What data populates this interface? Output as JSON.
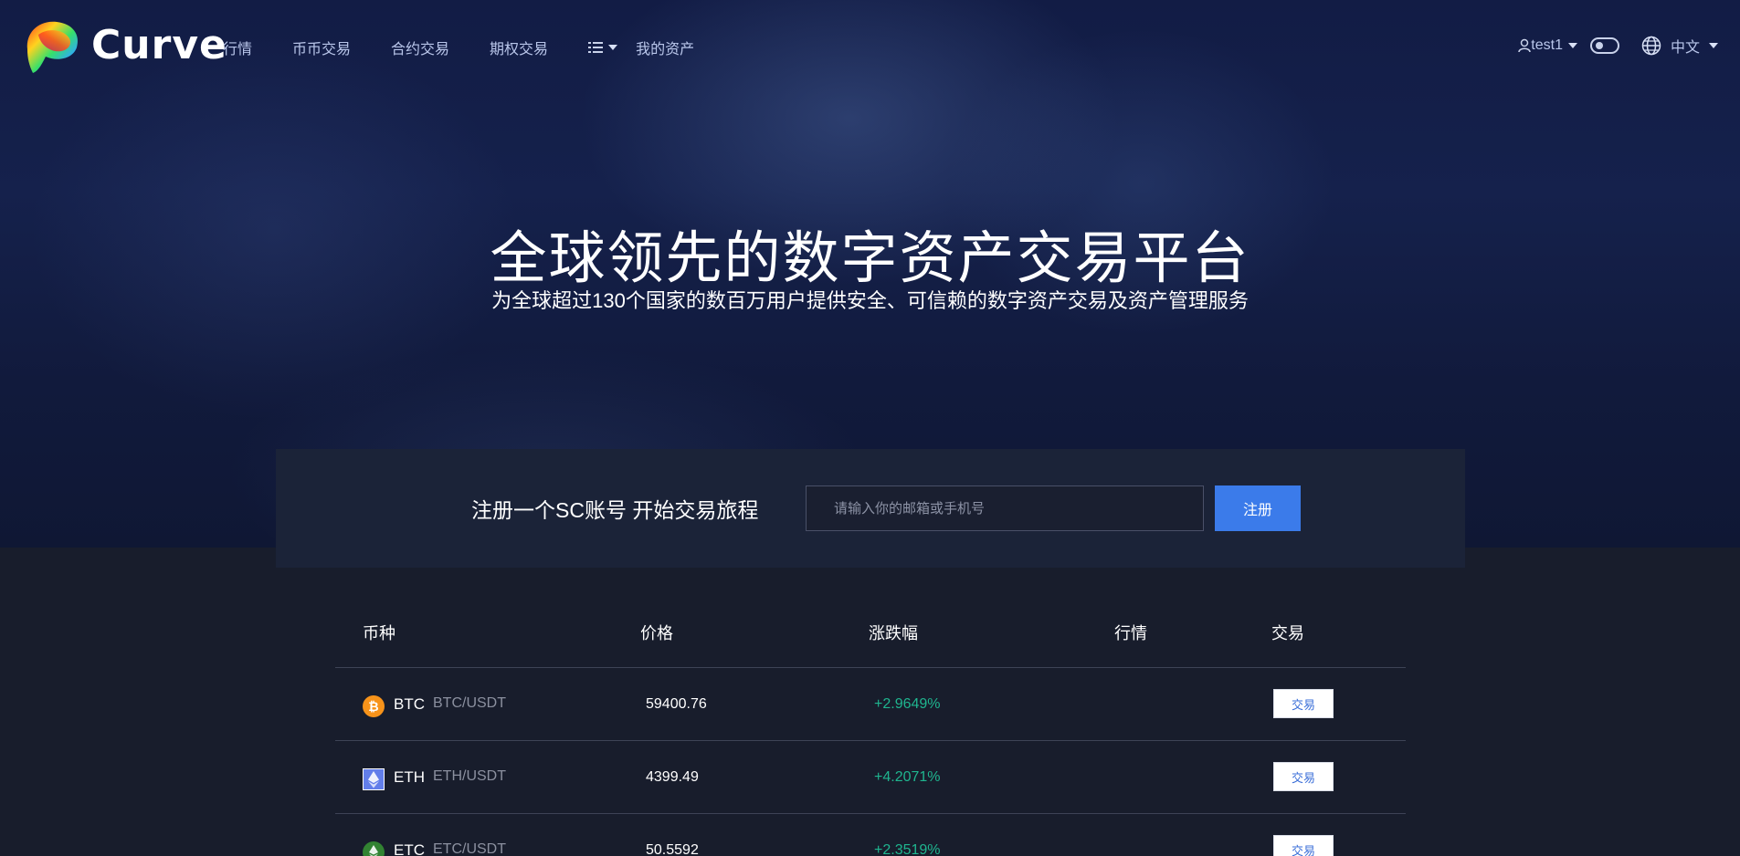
{
  "brand": {
    "name": "Curve"
  },
  "nav": {
    "links": [
      "行情",
      "币币交易",
      "合约交易",
      "期权交易"
    ],
    "assets": "我的资产",
    "user": "test1",
    "language": "中文"
  },
  "hero": {
    "title": "全球领先的数字资产交易平台",
    "subtitle": "为全球超过130个国家的数百万用户提供安全、可信赖的数字资产交易及资产管理服务"
  },
  "register": {
    "title": "注册一个SC账号 开始交易旅程",
    "placeholder": "请输入你的邮箱或手机号",
    "button": "注册"
  },
  "market": {
    "headers": [
      "币种",
      "价格",
      "涨跌幅",
      "行情",
      "交易"
    ],
    "rows": [
      {
        "symbol": "BTC",
        "pair": "BTC/USDT",
        "price": "59400.76",
        "change": "+2.9649%",
        "action": "交易",
        "icon": "btc-icon",
        "color": "#f7931a"
      },
      {
        "symbol": "ETH",
        "pair": "ETH/USDT",
        "price": "4399.49",
        "change": "+4.2071%",
        "action": "交易",
        "icon": "eth-icon",
        "color": "#627eea"
      },
      {
        "symbol": "ETC",
        "pair": "ETC/USDT",
        "price": "50.5592",
        "change": "+2.3519%",
        "action": "交易",
        "icon": "etc-icon",
        "color": "#328332"
      }
    ]
  },
  "colors": {
    "accent": "#3b7bea",
    "up": "#1fb58f",
    "background": "#181d2c"
  }
}
